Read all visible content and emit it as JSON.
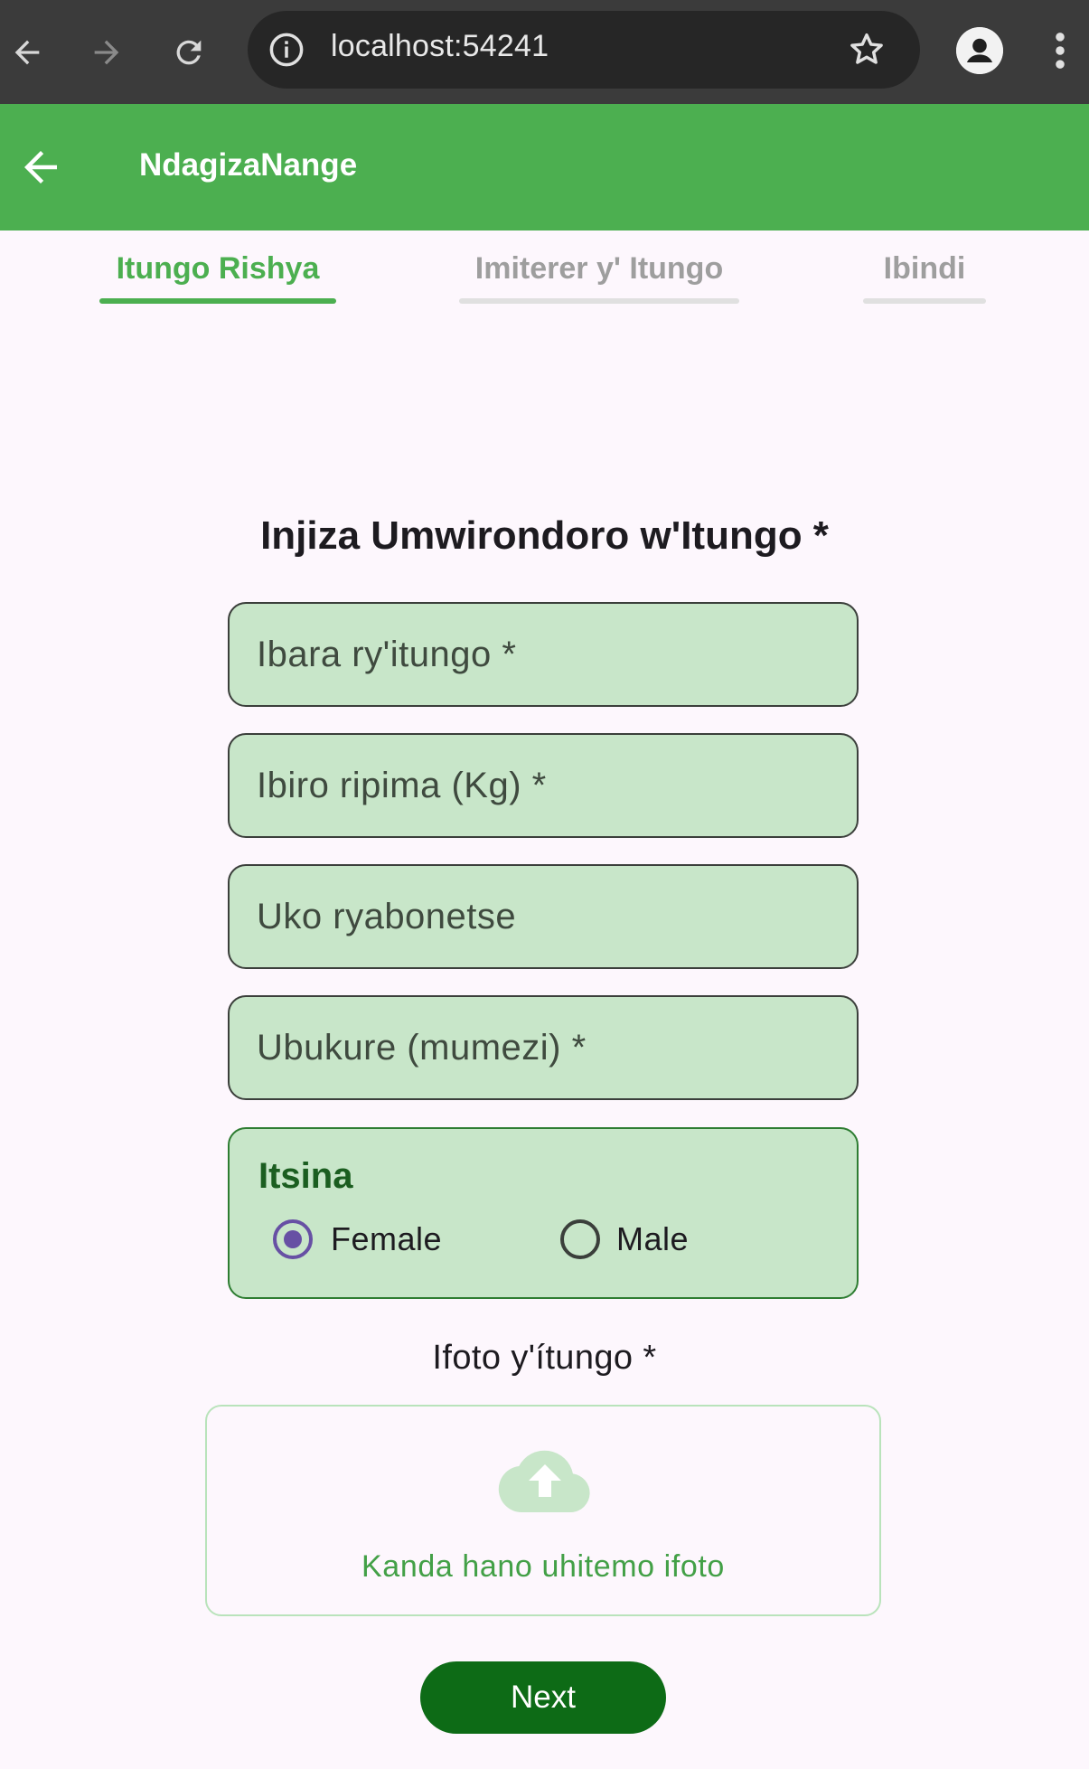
{
  "browser": {
    "url": "localhost:54241",
    "icons": [
      "back-icon",
      "forward-icon",
      "reload-icon",
      "info-icon",
      "star-icon",
      "profile-icon",
      "more-vert-icon"
    ]
  },
  "app_bar": {
    "title": "NdagizaNange",
    "color": "#4caf50",
    "back_icon": "arrow-back-icon"
  },
  "tabs": [
    {
      "label": "Itungo Rishya",
      "active": true
    },
    {
      "label": "Imiterer y' Itungo",
      "active": false
    },
    {
      "label": "Ibindi",
      "active": false
    }
  ],
  "form": {
    "title": "Injiza Umwirondoro w'Itungo *",
    "fields": [
      {
        "placeholder": "Ibara ry'itungo *",
        "value": ""
      },
      {
        "placeholder": "Ibiro ripima (Kg) *",
        "value": ""
      },
      {
        "placeholder": "Uko ryabonetse",
        "value": ""
      },
      {
        "placeholder": "Ubukure (mumezi) *",
        "value": ""
      }
    ],
    "gender": {
      "title": "Itsina",
      "options": [
        {
          "label": "Female",
          "selected": true
        },
        {
          "label": "Male",
          "selected": false
        }
      ]
    },
    "photo": {
      "label": "Ifoto y'ítungo *",
      "upload_text": "Kanda hano uhitemo ifoto",
      "icon": "cloud-upload-icon"
    },
    "next_button": "Next"
  },
  "colors": {
    "accent": "#4caf50",
    "field_bg": "#c8e6c9",
    "button": "#0d6b16",
    "radio_selected": "#6750a4",
    "page_bg": "#fdf7fd"
  }
}
